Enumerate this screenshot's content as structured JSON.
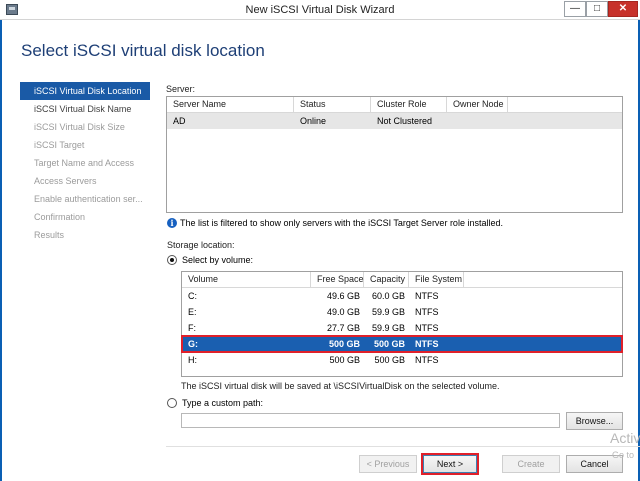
{
  "window": {
    "title": "New iSCSI Virtual Disk Wizard",
    "min_glyph": "—",
    "max_glyph": "□",
    "close_glyph": "✕"
  },
  "page_title": "Select iSCSI virtual disk location",
  "sidebar": {
    "items": [
      {
        "label": "iSCSI Virtual Disk Location",
        "state": "active"
      },
      {
        "label": "iSCSI Virtual Disk Name",
        "state": "done"
      },
      {
        "label": "iSCSI Virtual Disk Size",
        "state": "pending"
      },
      {
        "label": "iSCSI Target",
        "state": "pending"
      },
      {
        "label": "Target Name and Access",
        "state": "pending"
      },
      {
        "label": "Access Servers",
        "state": "pending"
      },
      {
        "label": "Enable authentication ser...",
        "state": "pending"
      },
      {
        "label": "Confirmation",
        "state": "pending"
      },
      {
        "label": "Results",
        "state": "pending"
      }
    ]
  },
  "server": {
    "label": "Server:",
    "columns": [
      "Server Name",
      "Status",
      "Cluster Role",
      "Owner Node"
    ],
    "rows": [
      {
        "name": "AD",
        "status": "Online",
        "cluster_role": "Not Clustered",
        "owner_node": ""
      }
    ],
    "filter_note": "The list is filtered to show only servers with the iSCSI Target Server role installed."
  },
  "storage": {
    "label": "Storage location:",
    "select_by_volume_label": "Select by volume:",
    "volume_columns": [
      "Volume",
      "Free Space",
      "Capacity",
      "File System"
    ],
    "volumes": [
      {
        "volume": "C:",
        "free": "49.6 GB",
        "capacity": "60.0 GB",
        "fs": "NTFS",
        "selected": false
      },
      {
        "volume": "E:",
        "free": "49.0 GB",
        "capacity": "59.9 GB",
        "fs": "NTFS",
        "selected": false
      },
      {
        "volume": "F:",
        "free": "27.7 GB",
        "capacity": "59.9 GB",
        "fs": "NTFS",
        "selected": false
      },
      {
        "volume": "G:",
        "free": "500 GB",
        "capacity": "500 GB",
        "fs": "NTFS",
        "selected": true
      },
      {
        "volume": "H:",
        "free": "500 GB",
        "capacity": "500 GB",
        "fs": "NTFS",
        "selected": false
      }
    ],
    "save_note": "The iSCSI virtual disk will be saved at \\iSCSIVirtualDisk on the selected volume.",
    "custom_path_label": "Type a custom path:",
    "custom_path_value": "",
    "browse_label": "Browse..."
  },
  "buttons": {
    "previous": "< Previous",
    "next": "Next >",
    "create": "Create",
    "cancel": "Cancel"
  },
  "watermark": {
    "line1": "Activ",
    "line2": "Go to"
  },
  "colors": {
    "accent": "#1a5aa6",
    "title_blue": "#1e3f76",
    "highlight_red": "#e0202a",
    "close_red": "#c7312a"
  }
}
